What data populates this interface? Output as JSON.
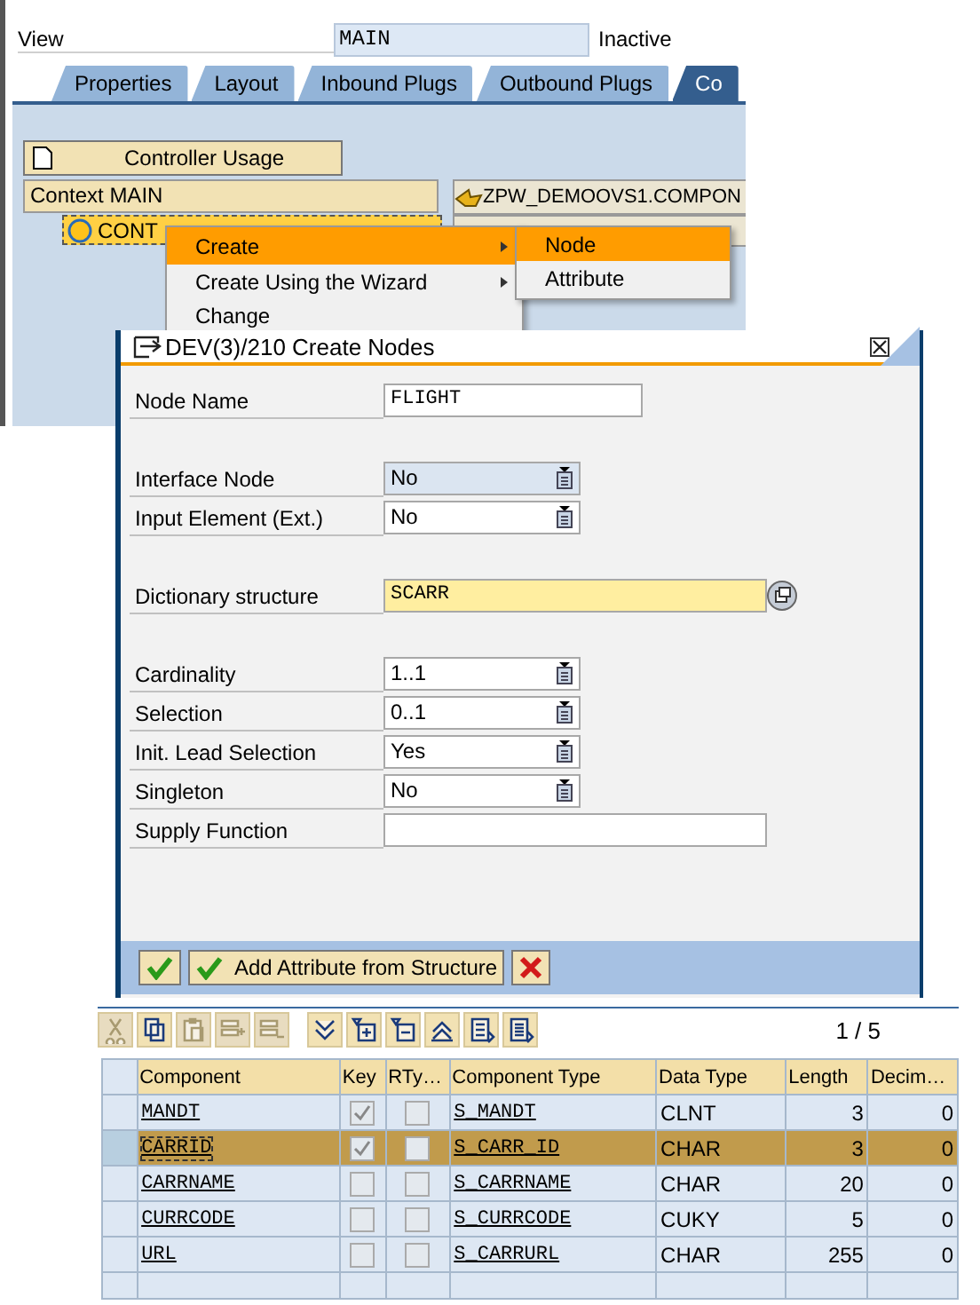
{
  "view": {
    "label": "View",
    "value": "MAIN",
    "status": "Inactive"
  },
  "tabs": [
    {
      "label": "Properties",
      "selected": false
    },
    {
      "label": "Layout",
      "selected": false
    },
    {
      "label": "Inbound Plugs",
      "selected": false
    },
    {
      "label": "Outbound Plugs",
      "selected": false
    },
    {
      "label": "Co",
      "selected": true
    }
  ],
  "controller_usage_button": "Controller Usage",
  "context": {
    "title": "Context MAIN",
    "node": "CONT"
  },
  "component_panel": {
    "title": "ZPW_DEMOOVS1.COMPON"
  },
  "context_menu": [
    {
      "label": "Create",
      "selected": true,
      "submenu": true
    },
    {
      "label": "Create Using the Wizard",
      "selected": false,
      "submenu": true
    },
    {
      "label": "Change",
      "selected": false,
      "submenu": false
    }
  ],
  "submenu": [
    {
      "label": "Node",
      "selected": true
    },
    {
      "label": "Attribute",
      "selected": false
    }
  ],
  "dialog": {
    "title": "DEV(3)/210 Create Nodes",
    "groups": [
      [
        {
          "label": "Node Name",
          "kind": "text",
          "value": "FLIGHT"
        }
      ],
      [
        {
          "label": "Interface Node",
          "kind": "dropdown",
          "value": "No",
          "disabled": true
        },
        {
          "label": "Input Element (Ext.)",
          "kind": "dropdown",
          "value": "No",
          "disabled": false
        }
      ],
      [
        {
          "label": "Dictionary structure",
          "kind": "lookup",
          "value": "SCARR"
        }
      ],
      [
        {
          "label": "Cardinality",
          "kind": "dropdown",
          "value": "1..1",
          "disabled": false
        },
        {
          "label": "Selection",
          "kind": "dropdown",
          "value": "0..1",
          "disabled": false
        },
        {
          "label": "Init. Lead Selection",
          "kind": "dropdown",
          "value": "Yes",
          "disabled": false
        },
        {
          "label": "Singleton",
          "kind": "dropdown",
          "value": "No",
          "disabled": false
        },
        {
          "label": "Supply Function",
          "kind": "wide"
        }
      ]
    ],
    "buttons": [
      {
        "kind": "ok"
      },
      {
        "kind": "ok",
        "label": "Add Attribute from Structure"
      },
      {
        "kind": "cancel"
      }
    ]
  },
  "toolbar": [
    {
      "kind": "cut",
      "enabled": false
    },
    {
      "kind": "copy",
      "enabled": true
    },
    {
      "kind": "paste",
      "enabled": false
    },
    {
      "kind": "append",
      "enabled": false
    },
    {
      "kind": "remove",
      "enabled": false
    },
    {
      "kind": "sort",
      "enabled": true
    },
    {
      "kind": "add",
      "enabled": true
    },
    {
      "kind": "minus",
      "enabled": true
    },
    {
      "kind": "up",
      "enabled": true
    },
    {
      "kind": "list",
      "enabled": true
    },
    {
      "kind": "doc",
      "enabled": true
    }
  ],
  "page_indicator": "1 / 5",
  "table": {
    "columns": [
      "Component",
      "Key",
      "RTy…",
      "Component Type",
      "Data Type",
      "Length",
      "Decim…"
    ],
    "rows": [
      {
        "component": "MANDT",
        "key": true,
        "rtype": false,
        "component_type": "S_MANDT",
        "data_type": "CLNT",
        "length": "3",
        "decimals": "0",
        "selected": false
      },
      {
        "component": "CARRID",
        "key": true,
        "rtype": false,
        "component_type": "S_CARR_ID",
        "data_type": "CHAR",
        "length": "3",
        "decimals": "0",
        "selected": true
      },
      {
        "component": "CARRNAME",
        "key": false,
        "rtype": false,
        "component_type": "S_CARRNAME",
        "data_type": "CHAR",
        "length": "20",
        "decimals": "0",
        "selected": false
      },
      {
        "component": "CURRCODE",
        "key": false,
        "rtype": false,
        "component_type": "S_CURRCODE",
        "data_type": "CUKY",
        "length": "5",
        "decimals": "0",
        "selected": false
      },
      {
        "component": "URL",
        "key": false,
        "rtype": false,
        "component_type": "S_CARRURL",
        "data_type": "CHAR",
        "length": "255",
        "decimals": "0",
        "selected": false
      }
    ]
  }
}
